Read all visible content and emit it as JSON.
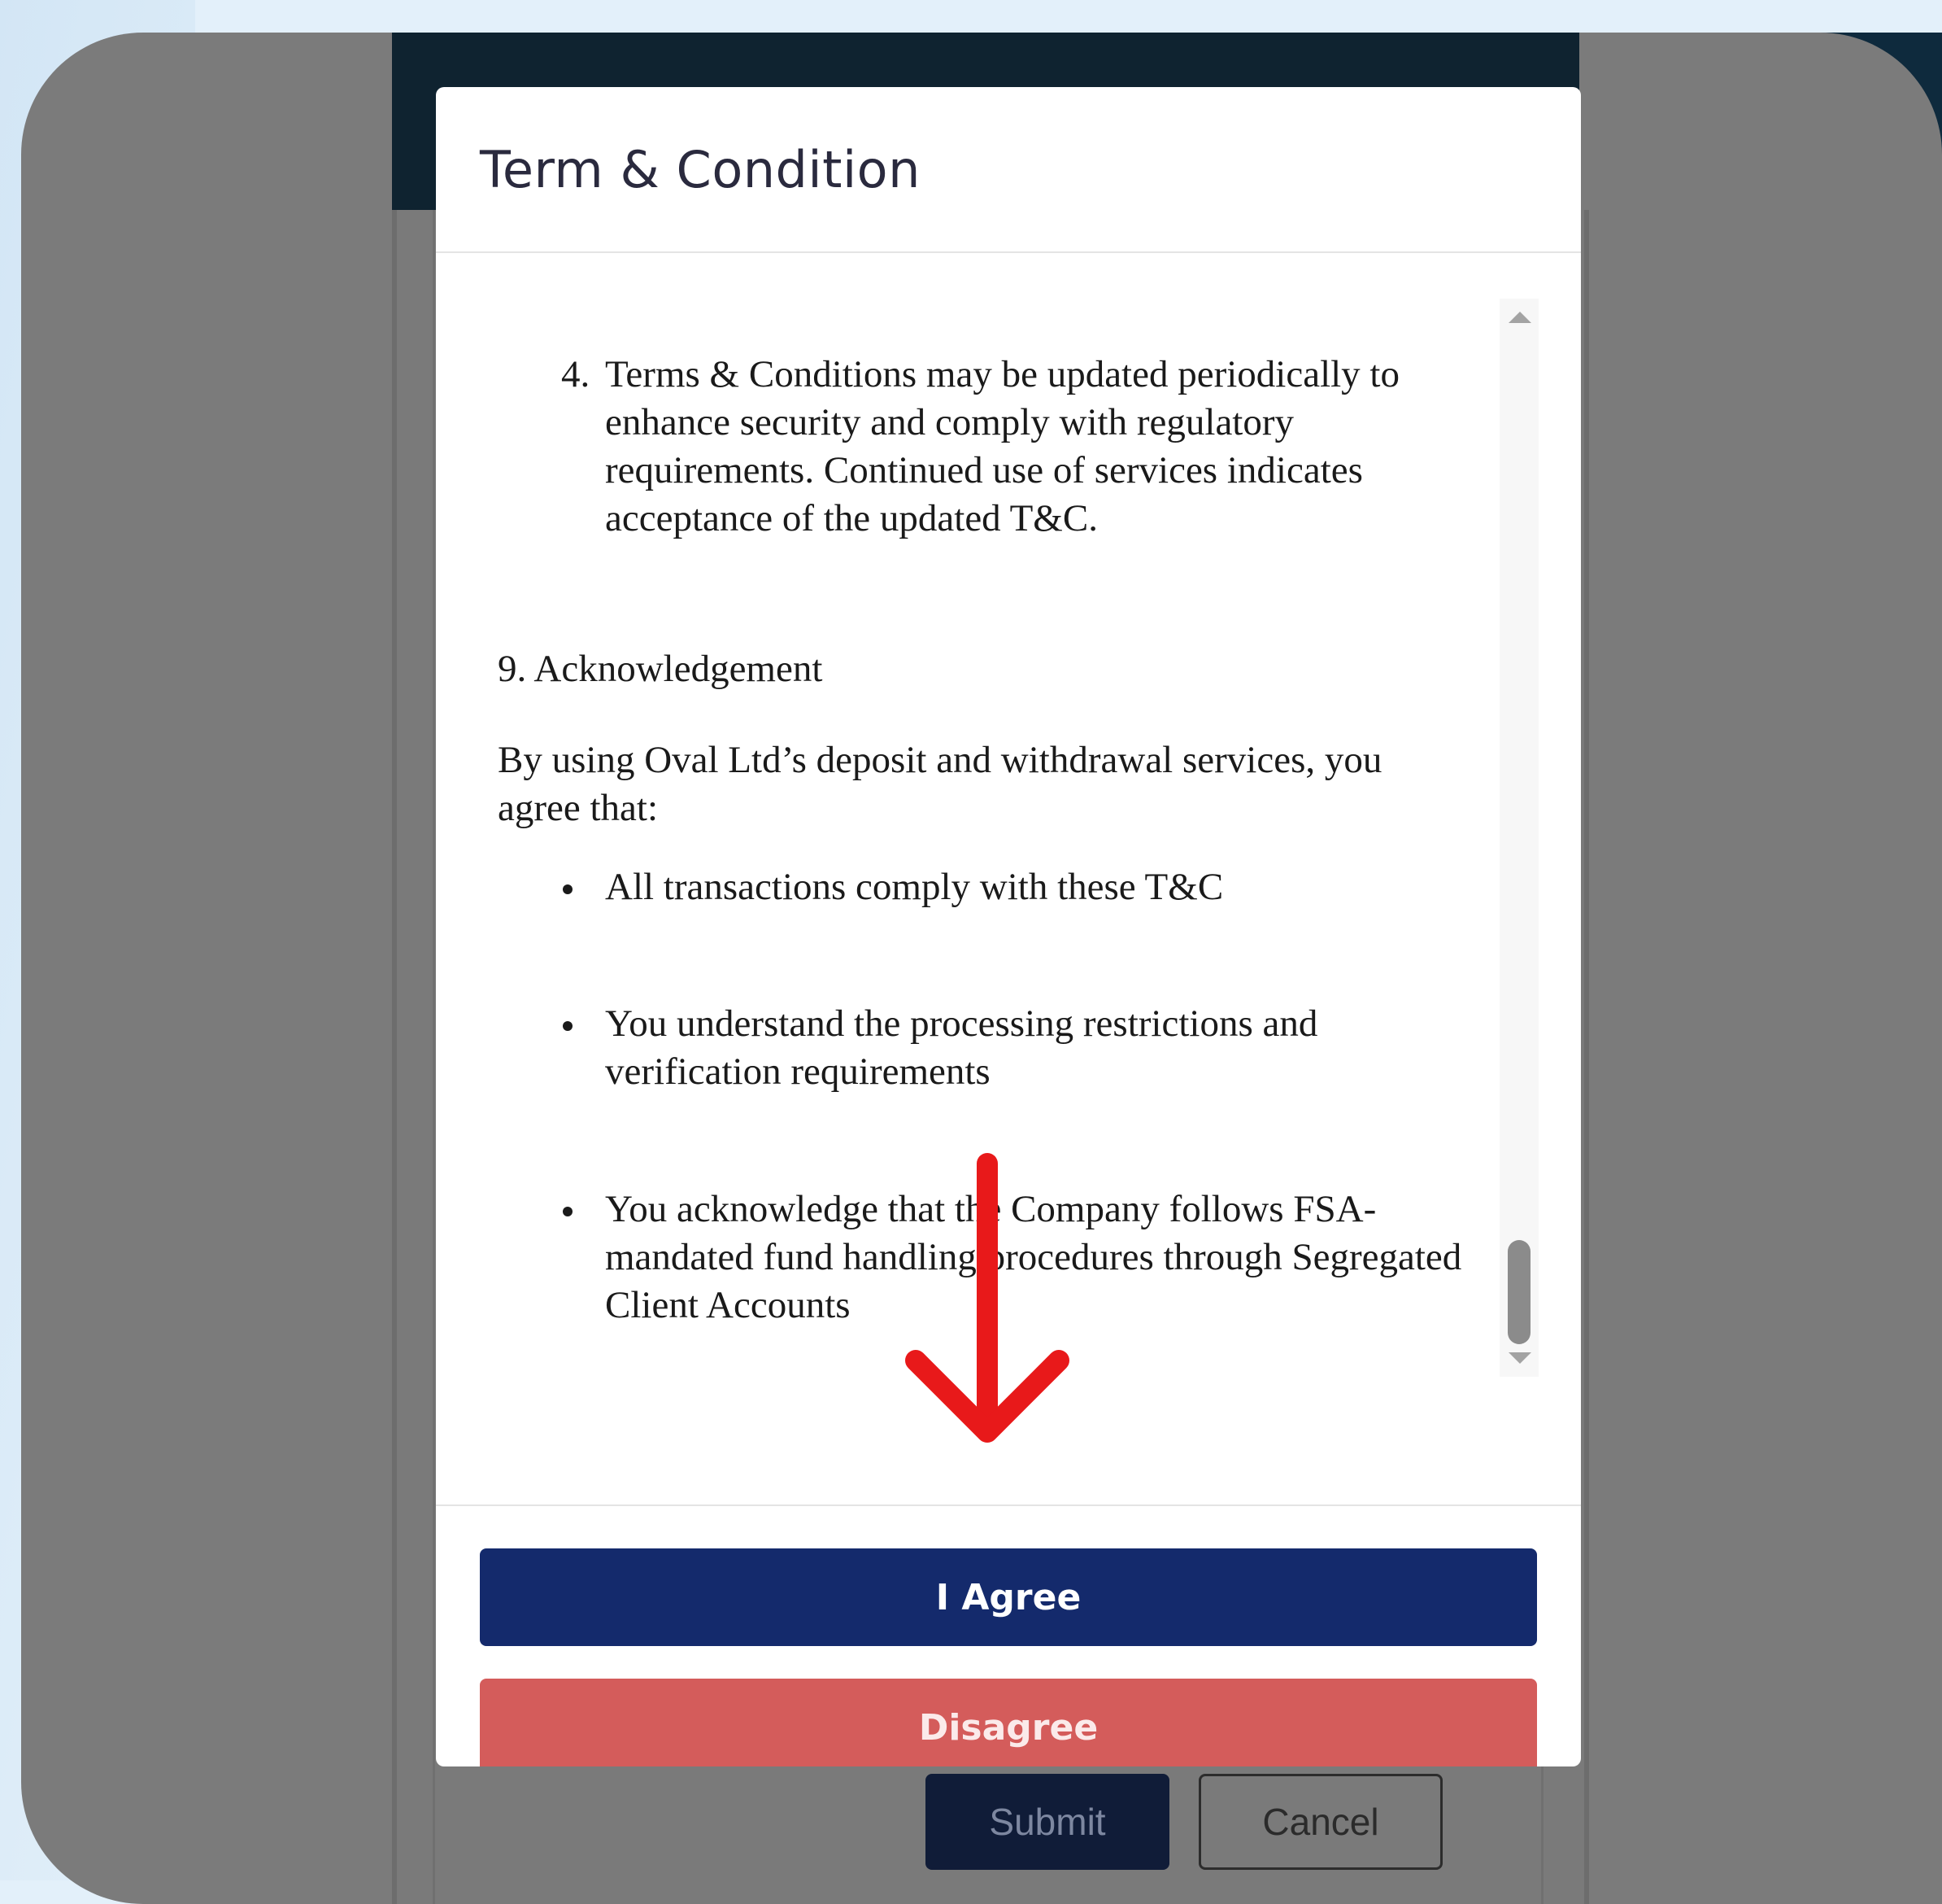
{
  "modal": {
    "title": "Term & Condition",
    "item4_number": "4.",
    "item4_text": "Terms & Conditions may be updated periodically to enhance security and comply with regulatory requirements. Continued use of services indicates acceptance of the updated T&C.",
    "section_title": "9. Acknowledgement",
    "section_intro": "By using Oval Ltd’s deposit and withdrawal services, you agree that:",
    "bullets": [
      "All transactions comply with these T&C",
      "You understand the processing restrictions and verification requirements",
      "You acknowledge that the Company follows FSA-mandated fund handling procedures through Segregated Client Accounts"
    ],
    "agree_label": "I Agree",
    "disagree_label": "Disagree"
  },
  "underlay": {
    "submit_label": "Submit",
    "cancel_label": "Cancel"
  },
  "colors": {
    "agree_button": "#142a6c",
    "disagree_button": "#d45c5b",
    "annotation_arrow": "#e8191a",
    "overlay": "#7b7b7b"
  }
}
